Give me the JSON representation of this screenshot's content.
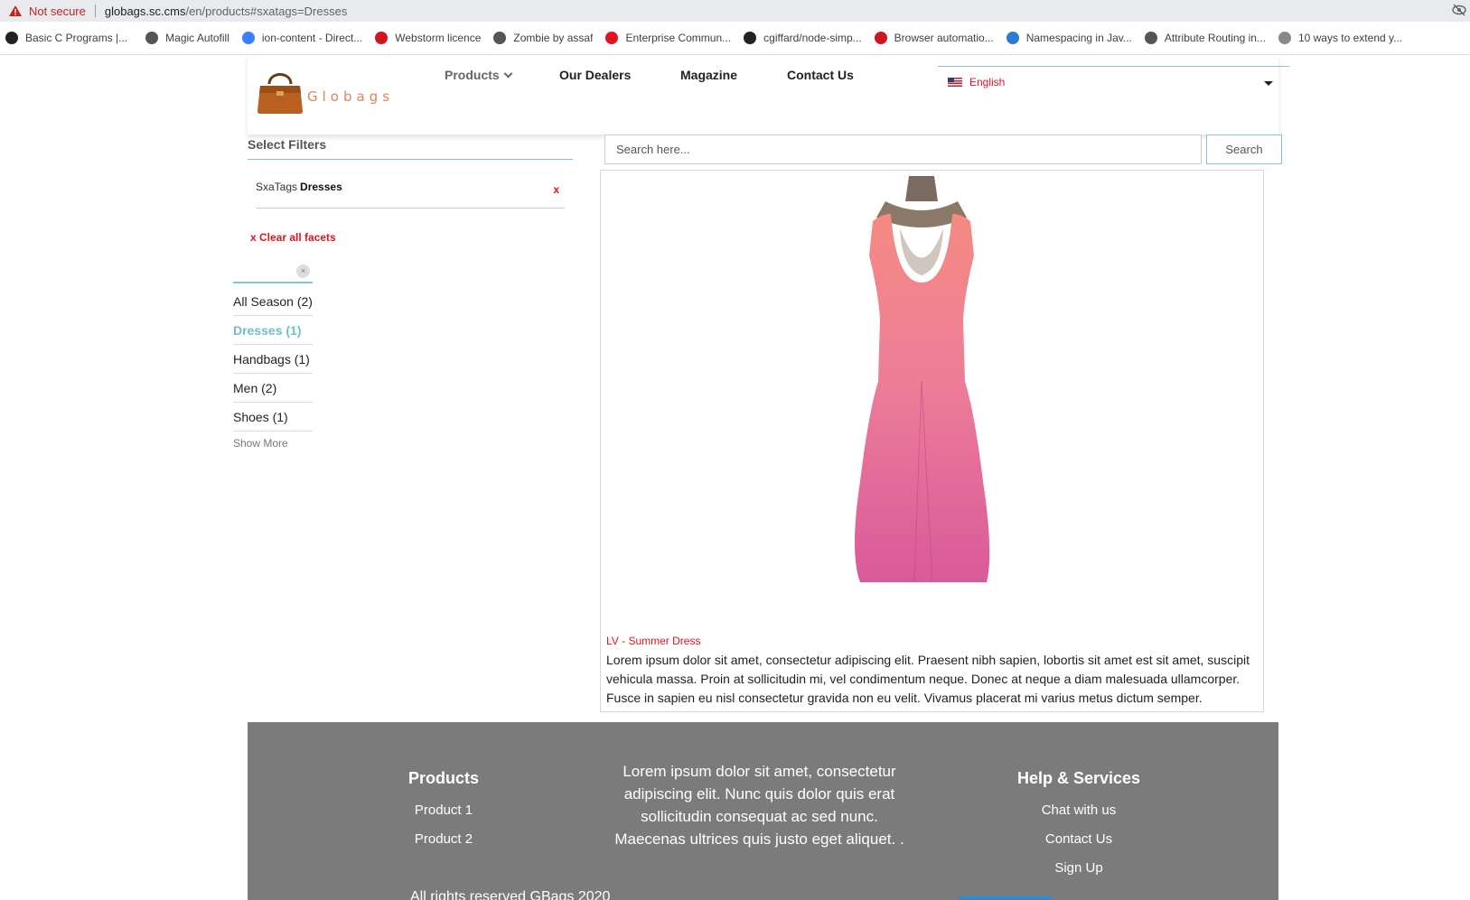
{
  "browser": {
    "security_label": "Not secure",
    "url_host": "globags.sc.cms",
    "url_path": "/en/products#sxatags=Dresses",
    "bookmarks": [
      {
        "label": "Basic C Programs |...",
        "icon": "circle-record-icon",
        "color": "#222222"
      },
      {
        "label": "Magic Autofill",
        "icon": "globe-icon",
        "color": "#555555"
      },
      {
        "label": "ion-content - Direct...",
        "icon": "ionic-icon",
        "color": "#3880ff"
      },
      {
        "label": "Webstorm licence",
        "icon": "c-red-icon",
        "color": "#d2141f"
      },
      {
        "label": "Zombie by assaf",
        "icon": "globe-icon",
        "color": "#555555"
      },
      {
        "label": "Enterprise Commun...",
        "icon": "ring-icon",
        "color": "#e2141f"
      },
      {
        "label": "cgiffard/node-simp...",
        "icon": "github-icon",
        "color": "#222222"
      },
      {
        "label": "Browser automatio...",
        "icon": "ad-icon",
        "color": "#d2141f"
      },
      {
        "label": "Namespacing in Jav...",
        "icon": "wordpress-icon",
        "color": "#2a7bd1"
      },
      {
        "label": "Attribute Routing in...",
        "icon": "globe-icon",
        "color": "#555555"
      },
      {
        "label": "10 ways to extend y...",
        "icon": "avatar-icon",
        "color": "#888888"
      }
    ]
  },
  "header": {
    "logo_text": "Globags",
    "nav": {
      "products": "Products",
      "dealers": "Our Dealers",
      "magazine": "Magazine",
      "contact": "Contact Us"
    },
    "language": "English"
  },
  "filters": {
    "title": "Select Filters",
    "active_facet_key": "SxaTags",
    "active_facet_value": "Dresses",
    "remove_label": "x",
    "clear_all": "x Clear all facets",
    "clear_input": "×",
    "categories": [
      {
        "label": "All Season (2)",
        "active": false
      },
      {
        "label": "Dresses (1)",
        "active": true
      },
      {
        "label": "Handbags (1)",
        "active": false
      },
      {
        "label": "Men (2)",
        "active": false
      },
      {
        "label": "Shoes (1)",
        "active": false
      }
    ],
    "show_more": "Show More"
  },
  "search": {
    "placeholder": "Search here...",
    "button": "Search"
  },
  "product": {
    "title": "LV - Summer Dress",
    "description": "Lorem ipsum dolor sit amet, consectetur adipiscing elit. Praesent nibh sapien, lobortis sit amet est sit amet, suscipit vehicula massa. Proin at sollicitudin mi, vel condimentum neque. Donec at neque a diam malesuada ullamcorper. Fusce in sapien eu nisl consectetur gravida non eu velit. Vivamus placerat mi varius metus dictum semper."
  },
  "footer": {
    "products_title": "Products",
    "product_links": [
      "Product 1",
      "Product 2"
    ],
    "center_text": "Lorem ipsum dolor sit amet, consectetur adipiscing elit. Nunc quis dolor quis erat sollicitudin consequat ac sed nunc. Maecenas ultrices quis justo eget aliquet. .",
    "help_title": "Help & Services",
    "help_links": [
      "Chat with us",
      "Contact Us",
      "Sign Up"
    ],
    "copyright": "All rights reserved GBags 2020"
  },
  "colors": {
    "accent": "#7fc6d2",
    "brand_red": "#e2141f",
    "active_facet": "#6fbfcb",
    "footer_bg": "#7b7b7b"
  }
}
